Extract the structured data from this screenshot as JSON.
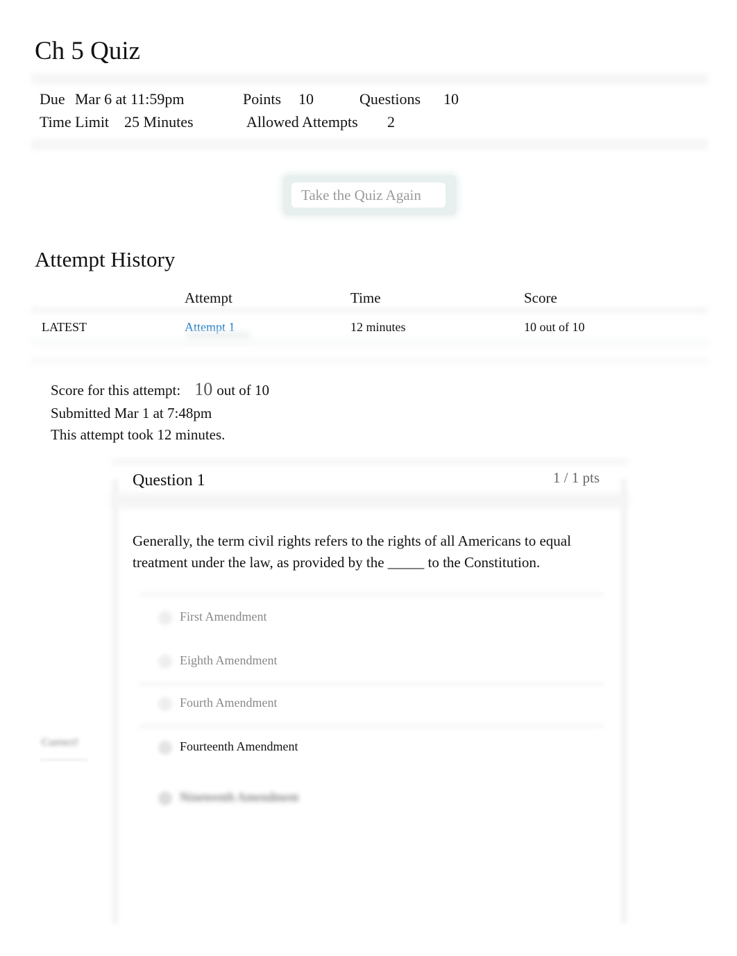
{
  "page": {
    "title": "Ch 5 Quiz"
  },
  "details": {
    "due_label": "Due",
    "due_value": "Mar 6 at 11:59pm",
    "points_label": "Points",
    "points_value": "10",
    "questions_label": "Questions",
    "questions_value": "10",
    "time_limit_label": "Time Limit",
    "time_limit_value": "25 Minutes",
    "allowed_attempts_label": "Allowed Attempts",
    "allowed_attempts_value": "2"
  },
  "actions": {
    "take_quiz_again_label": "Take the Quiz Again"
  },
  "attempt_history": {
    "title": "Attempt History",
    "columns": [
      "",
      "Attempt",
      "Time",
      "Score"
    ],
    "rows": [
      {
        "tag": "LATEST",
        "attempt": "Attempt 1",
        "time": "12 minutes",
        "score": "10 out of 10"
      }
    ]
  },
  "attempt_summary": {
    "score_label": "Score for this attempt:",
    "score_value": "10",
    "score_suffix": "out of 10",
    "submitted": "Submitted Mar 1 at 7:48pm",
    "duration": "This attempt took 12 minutes."
  },
  "question": {
    "title": "Question 1",
    "points": "1 / 1 pts",
    "text": "Generally, the term civil rights refers to the rights of all Americans to equal treatment under the law, as provided by the _____ to the Constitution.",
    "correct_flag": "Correct!",
    "answers": [
      {
        "label": "First Amendment",
        "selected": false
      },
      {
        "label": "Eighth Amendment",
        "selected": false
      },
      {
        "label": "Fourth Amendment",
        "selected": false
      },
      {
        "label": "Fourteenth Amendment",
        "selected": true
      },
      {
        "label": "Nineteenth Amendment",
        "selected": false
      }
    ]
  },
  "colors": {
    "link": "#1a78c2",
    "muted_text": "#888888"
  }
}
